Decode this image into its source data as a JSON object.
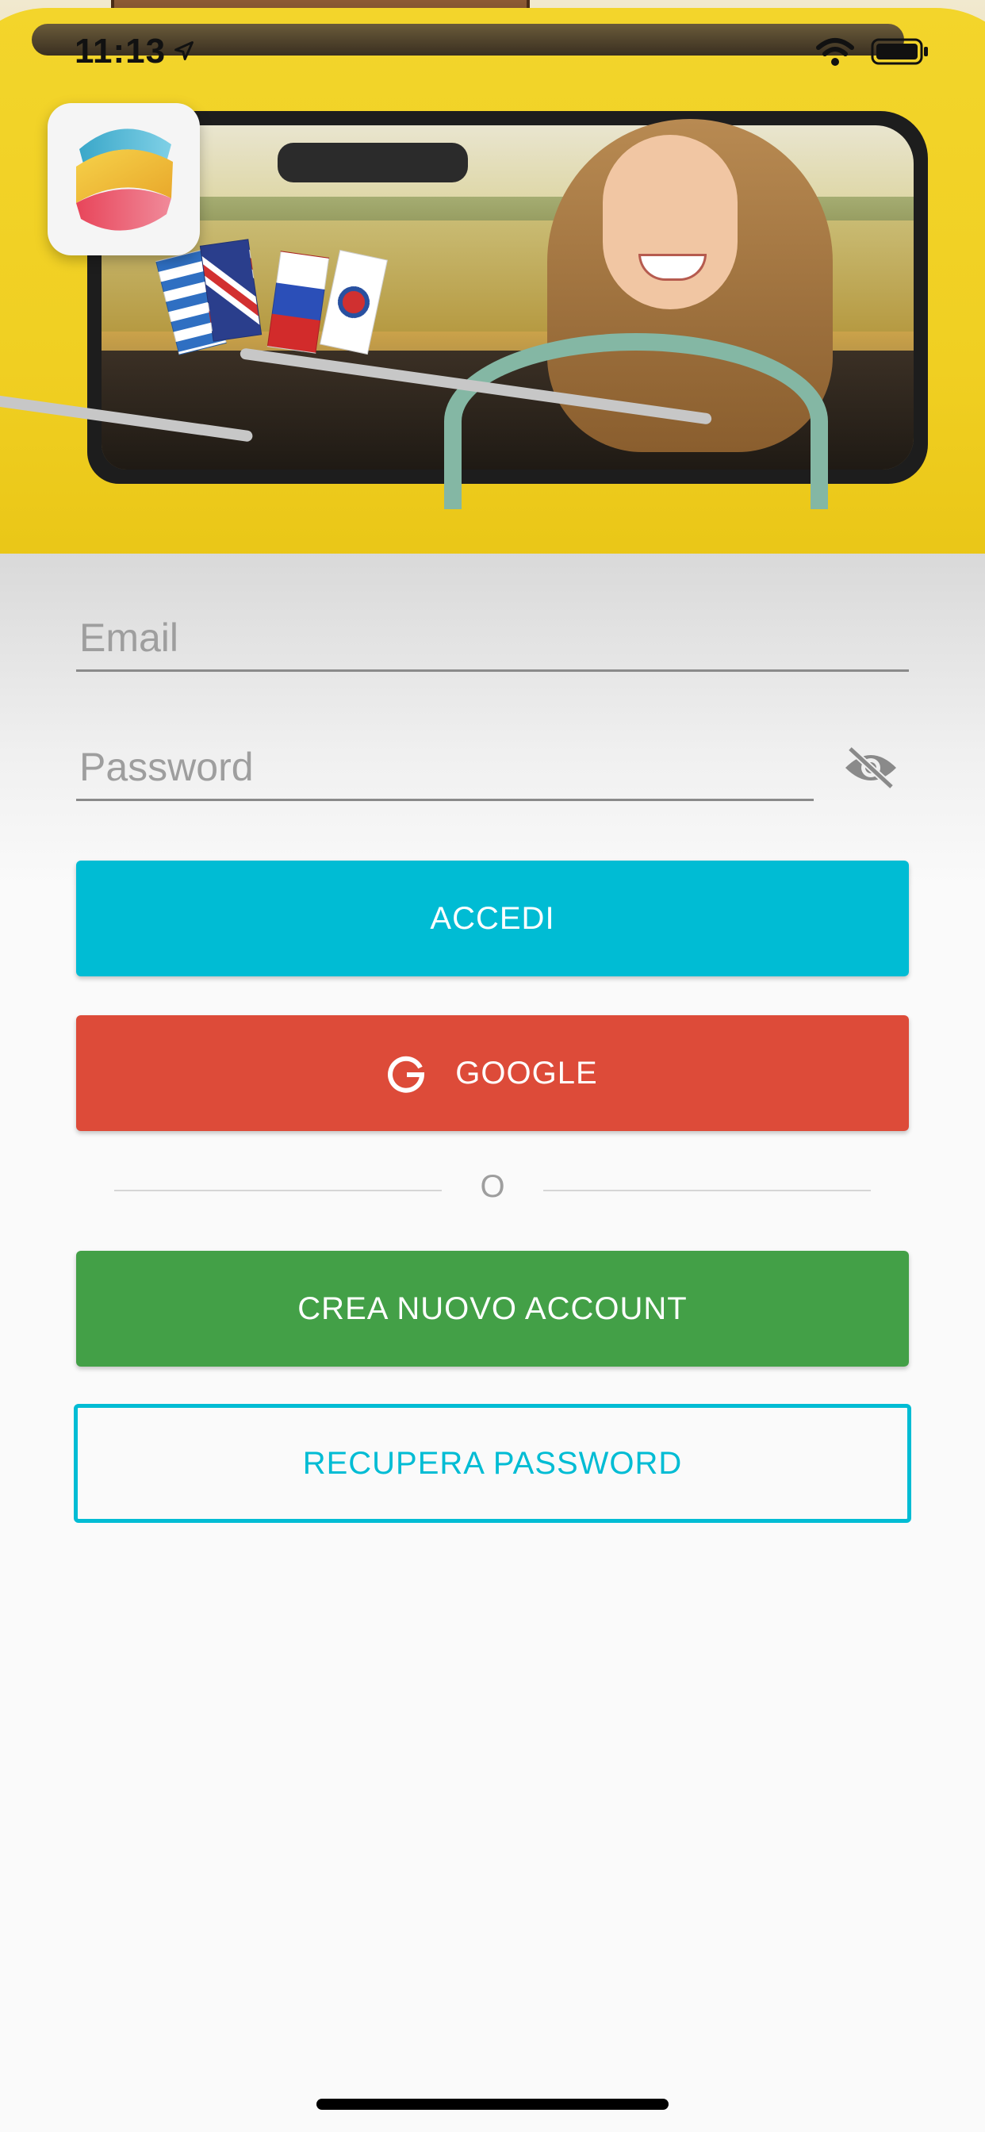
{
  "status_bar": {
    "time": "11:13",
    "icons": [
      "location-arrow-icon",
      "wifi-icon",
      "battery-icon"
    ]
  },
  "hero": {
    "image_semantic": "woman-driving-yellow-car-photo",
    "logo_icon": "app-logo-icon"
  },
  "form": {
    "email_placeholder": "Email",
    "email_value": "",
    "password_placeholder": "Password",
    "password_value": "",
    "password_toggle_icon": "eye-off-icon"
  },
  "buttons": {
    "accedi": "ACCEDI",
    "google": "GOOGLE",
    "google_icon": "google-g-icon",
    "or_separator": "O",
    "crea": "CREA NUOVO ACCOUNT",
    "recupera": "RECUPERA PASSWORD"
  },
  "colors": {
    "accedi": "#00bcd4",
    "google": "#dd4b39",
    "crea": "#43a047",
    "recupera_border": "#00bcd4",
    "background": "#fafafa"
  }
}
